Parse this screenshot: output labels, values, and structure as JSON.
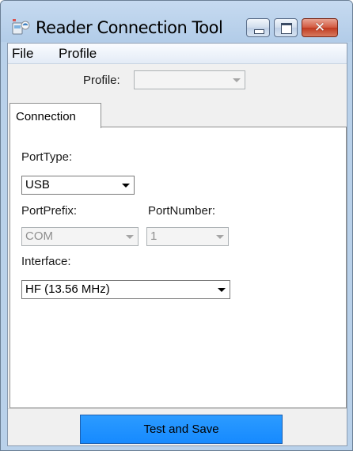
{
  "window": {
    "title": "Reader Connection Tool",
    "close_glyph": "✕",
    "icons": {
      "app": "reader-app-icon",
      "minimize": "minimize-icon",
      "maximize": "maximize-icon",
      "close": "close-icon"
    }
  },
  "menu": {
    "items": [
      {
        "label": "File"
      },
      {
        "label": "Profile"
      }
    ]
  },
  "profile": {
    "label": "Profile:",
    "value": "",
    "enabled": false
  },
  "tabs": [
    {
      "label": "Connection",
      "active": true
    }
  ],
  "connection": {
    "port_type": {
      "label": "PortType:",
      "value": "USB",
      "enabled": true
    },
    "port_prefix": {
      "label": "PortPrefix:",
      "value": "COM",
      "enabled": false
    },
    "port_number": {
      "label": "PortNumber:",
      "value": "1",
      "enabled": false
    },
    "interface": {
      "label": "Interface:",
      "value": "HF (13.56 MHz)",
      "enabled": true
    }
  },
  "actions": {
    "test_and_save": "Test and Save"
  },
  "colors": {
    "title_bar": "#b9d1ea",
    "client_background": "#f0f0f0",
    "panel_background": "#ffffff",
    "test_button": "#1e90ff",
    "close_button": "#c8442a"
  }
}
